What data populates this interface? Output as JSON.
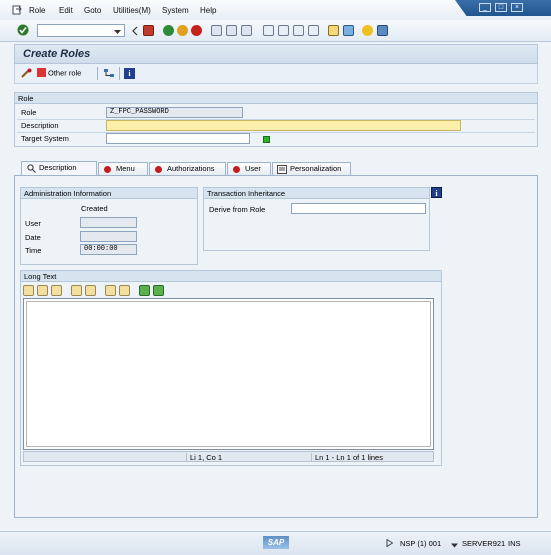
{
  "menu": {
    "items": [
      "Role",
      "Edit",
      "Goto",
      "Utilities(M)",
      "System",
      "Help"
    ]
  },
  "title": "Create Roles",
  "app_toolbar": {
    "other_role_label": "Other role"
  },
  "role_group": {
    "header": "Role",
    "role_label": "Role",
    "role_value": "Z_FPC_PASSWORD",
    "description_label": "Description",
    "description_value": "",
    "target_system_label": "Target System",
    "target_system_value": ""
  },
  "tabs": [
    "Description",
    "Menu",
    "Authorizations",
    "User",
    "Personalization"
  ],
  "admin_info": {
    "header": "Administration Information",
    "created_label": "Created",
    "user_label": "User",
    "user_value": "",
    "date_label": "Date",
    "date_value": "",
    "time_label": "Time",
    "time_value": "00:00:00"
  },
  "transaction_inheritance": {
    "header": "Transaction Inheritance",
    "derive_label": "Derive from Role",
    "derive_value": ""
  },
  "long_text": {
    "header": "Long Text",
    "cursor_position": "Li 1, Co 1",
    "line_info": "Ln 1 - Ln 1 of 1 lines"
  },
  "status_bar": {
    "logo_text": "SAP",
    "system_info": "NSP (1) 001",
    "server": "SERVER921",
    "mode": "INS"
  },
  "colors": {
    "required_field": "#fbefa9",
    "title_text": "#1d2e44",
    "active_green": "#2fb12f"
  }
}
